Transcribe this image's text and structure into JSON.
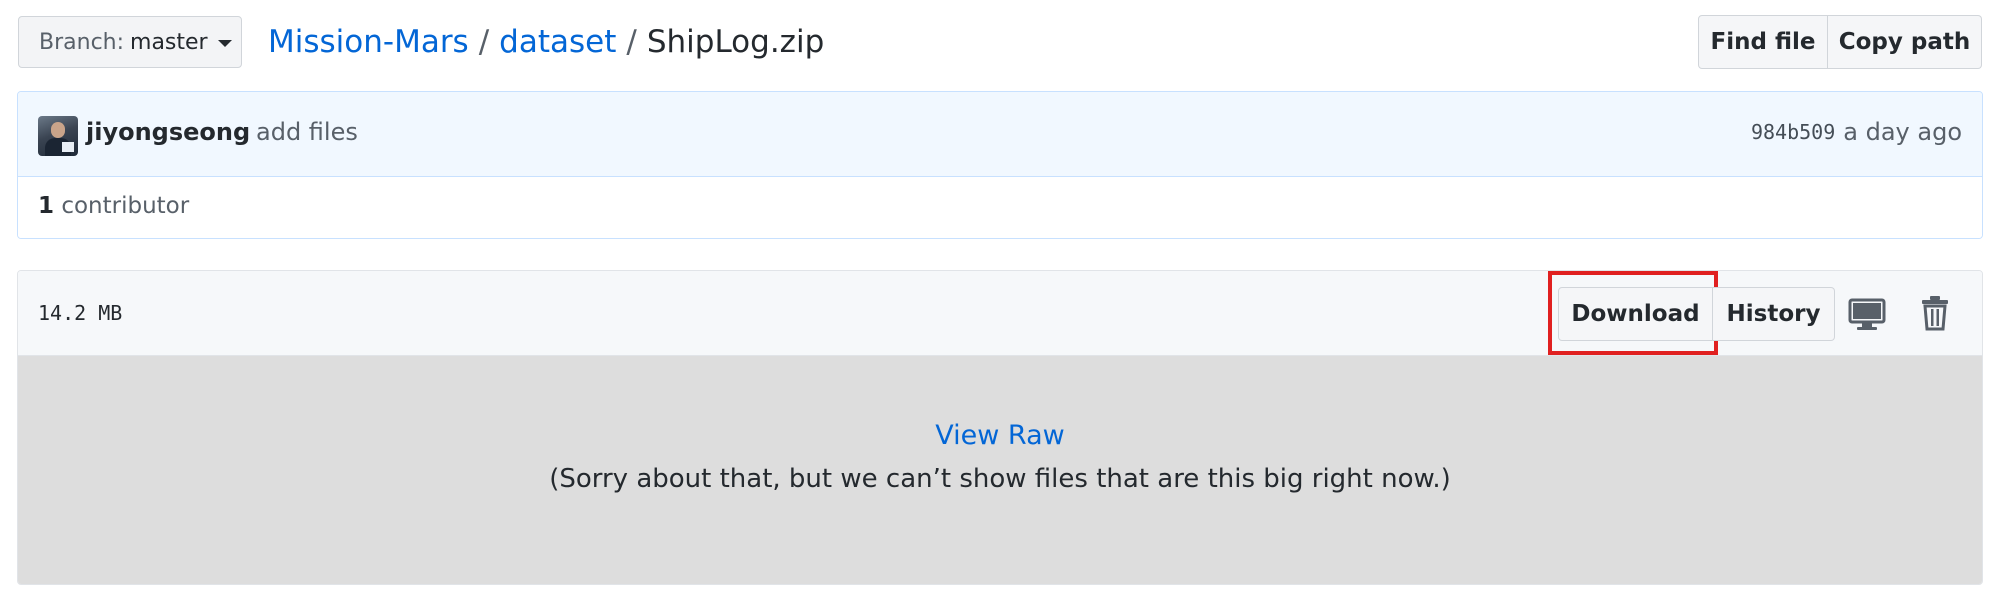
{
  "branch": {
    "prefix": "Branch:",
    "name": "master"
  },
  "breadcrumb": {
    "repo": "Mission-Mars",
    "folder": "dataset",
    "file": "ShipLog.zip",
    "separator": "/"
  },
  "top_actions": {
    "find_file": "Find file",
    "copy_path": "Copy path"
  },
  "commit": {
    "author": "jiyongseong",
    "message": "add files",
    "sha": "984b509",
    "time": "a day ago",
    "contributors_count": "1",
    "contributors_label": "contributor"
  },
  "file": {
    "size": "14.2 MB",
    "download_label": "Download",
    "history_label": "History",
    "view_raw": "View Raw",
    "too_big_message": "(Sorry about that, but we can’t show files that are this big right now.)"
  },
  "colors": {
    "link": "#0366d6",
    "highlight": "#e02020",
    "commit_bg": "#f1f8ff",
    "body_bg": "#dddddd"
  },
  "icons": {
    "branch_caret": "chevron-down-icon",
    "desktop": "desktop-icon",
    "delete": "trash-icon"
  }
}
